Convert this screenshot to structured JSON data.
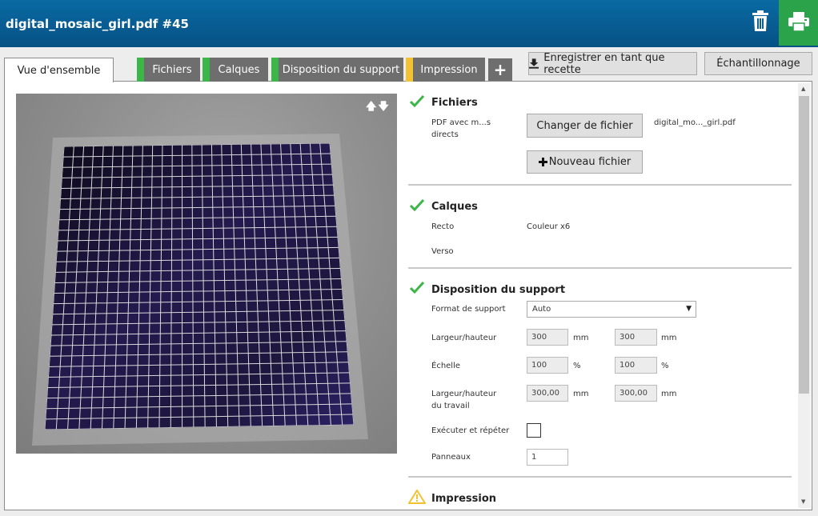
{
  "header": {
    "title": "digital_mosaic_girl.pdf #45",
    "trash_icon": "trash-icon",
    "print_icon": "printer-icon",
    "print_color": "#2aa34a"
  },
  "tabs": [
    {
      "label": "Vue d'ensemble",
      "active": true
    },
    {
      "label": "Fichiers",
      "status_color": "#3cb549"
    },
    {
      "label": "Calques",
      "status_color": "#3cb549"
    },
    {
      "label": "Disposition du support",
      "status_color": "#3cb549"
    },
    {
      "label": "Impression",
      "status_color": "#f2c232"
    },
    {
      "label": "+"
    }
  ],
  "actions": {
    "save_recipe": "Enregistrer en tant que recette",
    "sampling": "Échantillonnage"
  },
  "preview": {
    "arrows": "🡅🡇"
  },
  "fichiers": {
    "title": "Fichiers",
    "pdf_label": "PDF avec m...s directs",
    "change_button": "Changer de fichier",
    "file_name": "digital_mo..._girl.pdf",
    "new_button": "Nouveau fichier"
  },
  "calques": {
    "title": "Calques",
    "recto_label": "Recto",
    "recto_value": "Couleur x6",
    "verso_label": "Verso"
  },
  "disposition": {
    "title": "Disposition du support",
    "format_label": "Format de support",
    "format_value": "Auto",
    "size_label": "Largeur/hauteur",
    "width": "300",
    "height": "300",
    "size_unit": "mm",
    "scale_label": "Échelle",
    "scale_x": "100",
    "scale_y": "100",
    "scale_unit": "%",
    "work_label": "Largeur/hauteur du travail",
    "work_width": "300,00",
    "work_height": "300,00",
    "work_unit": "mm",
    "step_repeat_label": "Exécuter et répéter",
    "panels_label": "Panneaux",
    "panels_value": "1"
  },
  "impression": {
    "title": "Impression",
    "status": "warning"
  }
}
